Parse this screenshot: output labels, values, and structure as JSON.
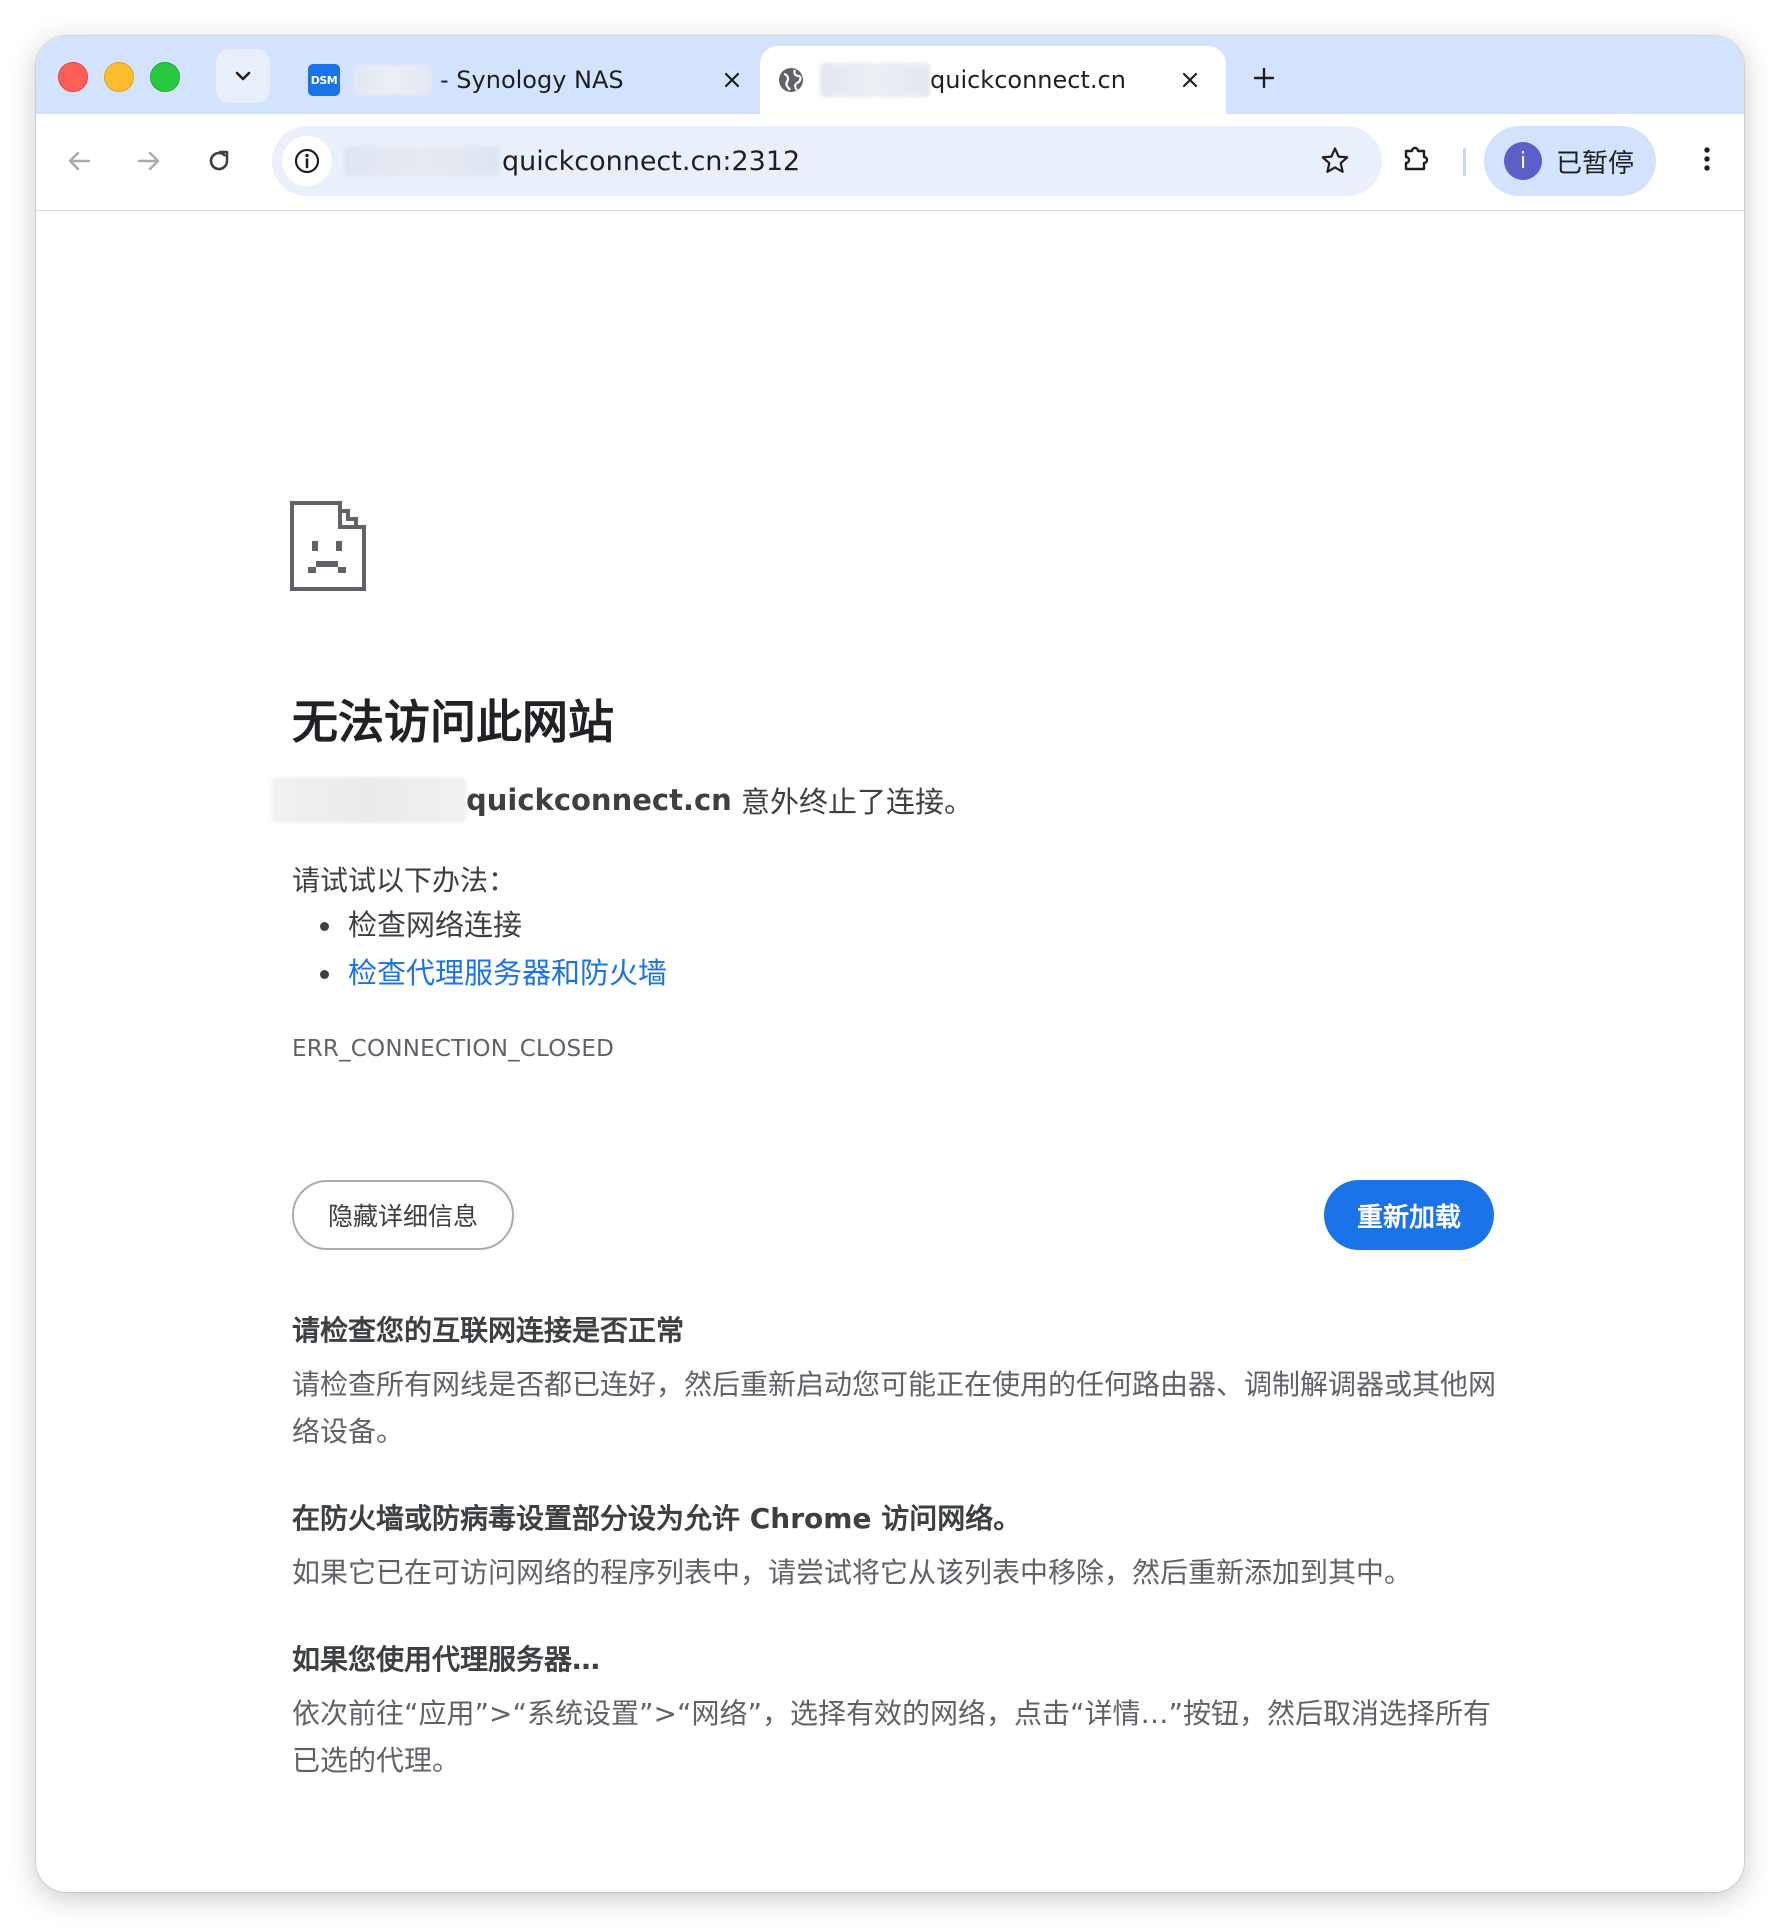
{
  "tabs": {
    "inactive": {
      "title": "- Synology NAS",
      "favicon_text": "DSM"
    },
    "active": {
      "title": "quickconnect.cn"
    }
  },
  "toolbar": {
    "url": "quickconnect.cn:2312",
    "profile_label": "已暂停",
    "avatar_letter": "i"
  },
  "error": {
    "title": "无法访问此网站",
    "host": "quickconnect.cn",
    "summary_suffix": " 意外终止了连接。",
    "try_label": "请试试以下办法：",
    "suggestions": [
      "检查网络连接",
      "检查代理服务器和防火墙"
    ],
    "code": "ERR_CONNECTION_CLOSED"
  },
  "buttons": {
    "details": "隐藏详细信息",
    "reload": "重新加载"
  },
  "details": [
    {
      "heading": "请检查您的互联网连接是否正常",
      "body": "请检查所有网线是否都已连好，然后重新启动您可能正在使用的任何路由器、调制解调器或其他网络设备。"
    },
    {
      "heading": "在防火墙或防病毒设置部分设为允许 Chrome 访问网络。",
      "body": "如果它已在可访问网络的程序列表中，请尝试将它从该列表中移除，然后重新添加到其中。"
    },
    {
      "heading": "如果您使用代理服务器…",
      "body": "依次前往“应用”>“系统设置”>“网络”，选择有效的网络，点击“详情…”按钮，然后取消选择所有已选的代理。"
    }
  ],
  "colors": {
    "tabstrip": "#d3e3fd",
    "accent": "#1a73e8",
    "omnibox": "#e9effb"
  }
}
